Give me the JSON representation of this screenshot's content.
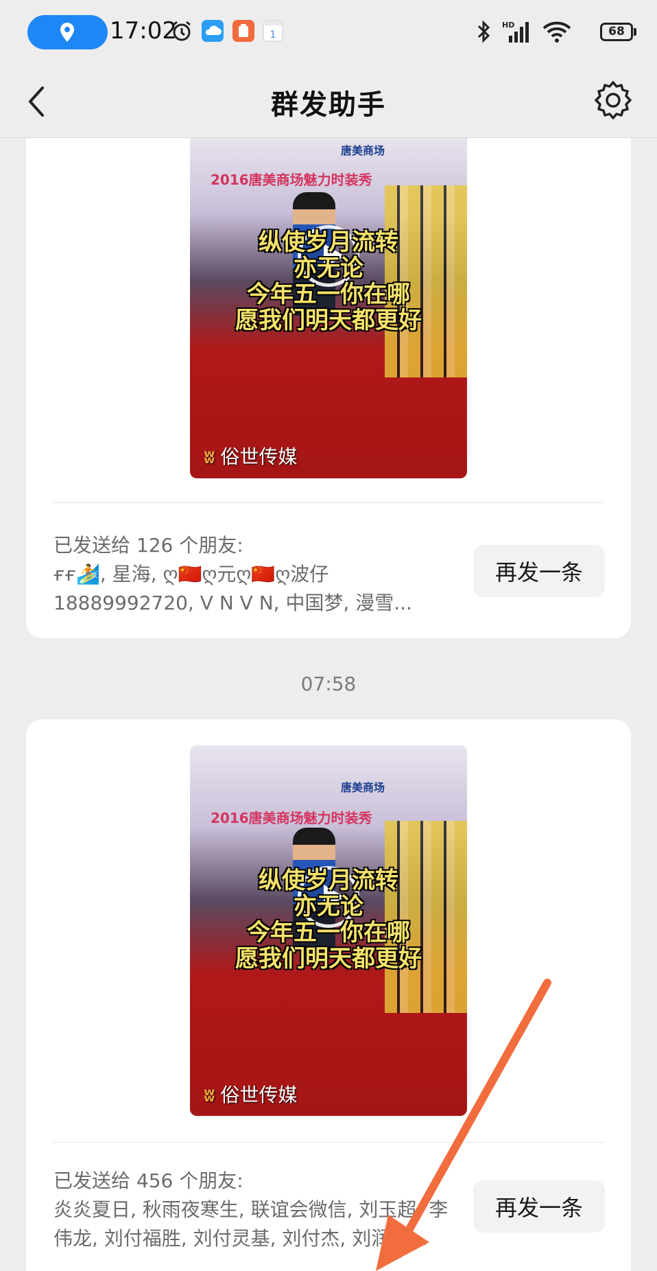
{
  "status_bar": {
    "time": "17:02",
    "battery": "68"
  },
  "header": {
    "title": "群发助手"
  },
  "messages": [
    {
      "video": {
        "banner": "2016唐美商场魅力时装秀",
        "mall_name": "唐美商场",
        "subtitle_lines": [
          "纵使岁月流转",
          "亦无论",
          "今年五一你在哪",
          "愿我们明天都更好"
        ],
        "watermark": "俗世传媒"
      },
      "sent_to": "已发送给 126 个朋友:",
      "recipients_line1": "ғғ🏄, 星海, ღ🇨🇳ღ元ღ🇨🇳ღ波仔",
      "recipients_line2": "18889992720, V N V N, 中国梦, 漫雪...",
      "resend_label": "再发一条"
    },
    {
      "time": "07:58",
      "video": {
        "banner": "2016唐美商场魅力时装秀",
        "mall_name": "唐美商场",
        "subtitle_lines": [
          "纵使岁月流转",
          "亦无论",
          "今年五一你在哪",
          "愿我们明天都更好"
        ],
        "watermark": "俗世传媒"
      },
      "sent_to": "已发送给 456 个朋友:",
      "recipients_line1": "炎炎夏日, 秋雨夜寒生, 联谊会微信, 刘玉超, 李",
      "recipients_line2": "伟龙, 刘付福胜, 刘付灵基, 刘付杰, 刘润华...",
      "resend_label": "再发一条"
    }
  ],
  "colors": {
    "background": "#ededed",
    "location_pill": "#1f86f5",
    "annotation_arrow": "#f26d3d"
  },
  "icons": [
    "location-icon",
    "alarm-icon",
    "cloud-icon",
    "app-icon",
    "calendar-icon",
    "bluetooth-icon",
    "signal-icon",
    "wifi-icon",
    "battery-icon",
    "back-icon",
    "gear-icon",
    "play-icon"
  ]
}
